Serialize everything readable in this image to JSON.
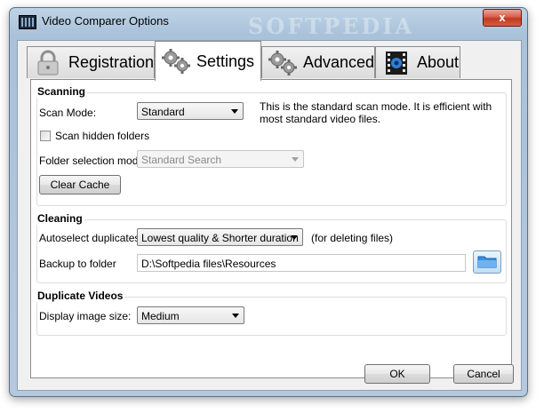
{
  "window": {
    "title": "Video Comparer Options",
    "close_glyph": "x"
  },
  "watermark": "SOFTPEDIA",
  "tabs": [
    {
      "label": "Registration",
      "icon": "lock-icon"
    },
    {
      "label": "Settings",
      "icon": "gears-icon"
    },
    {
      "label": "Advanced",
      "icon": "gears-icon"
    },
    {
      "label": "About",
      "icon": "film-icon"
    }
  ],
  "active_tab": "Settings",
  "scanning": {
    "title": "Scanning",
    "scan_mode_label": "Scan Mode:",
    "scan_mode_value": "Standard",
    "scan_mode_description": "This is the standard scan mode. It is efficient with most standard video files.",
    "scan_hidden_label": "Scan hidden folders",
    "scan_hidden_checked": false,
    "folder_mode_label": "Folder selection mode:",
    "folder_mode_value": "Standard Search",
    "clear_cache_label": "Clear Cache"
  },
  "cleaning": {
    "title": "Cleaning",
    "autoselect_label": "Autoselect duplicates:",
    "autoselect_value": "Lowest quality & Shorter duration",
    "autoselect_note": "(for deleting files)",
    "backup_label": "Backup to folder",
    "backup_value": "D:\\Softpedia files\\Resources"
  },
  "duplicate_videos": {
    "title": "Duplicate Videos",
    "display_size_label": "Display image size:",
    "display_size_value": "Medium"
  },
  "buttons": {
    "ok": "OK",
    "cancel": "Cancel"
  },
  "colors": {
    "accent": "#a9c2da",
    "close": "#c03a24"
  }
}
